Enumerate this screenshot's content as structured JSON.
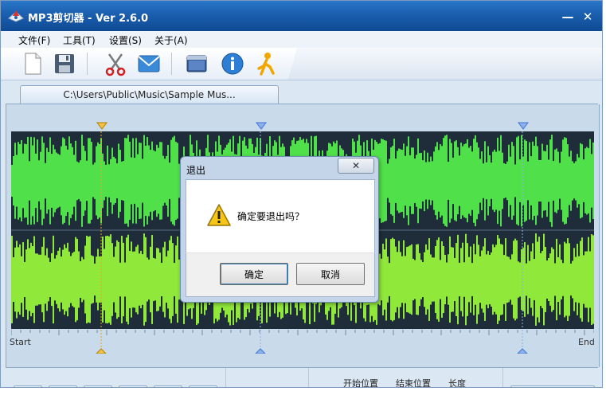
{
  "window": {
    "title": "MP3剪切器 - Ver 2.6.0",
    "minimize": "—",
    "close": "✕"
  },
  "menu": {
    "items": [
      "文件(F)",
      "工具(T)",
      "设置(S)",
      "关于(A)"
    ]
  },
  "toolbar": {
    "icons": [
      "new-file-icon",
      "save-icon",
      "cut-scissors-icon",
      "email-icon",
      "window-icon",
      "info-icon",
      "runner-icon"
    ]
  },
  "tab": {
    "label": "C:\\Users\\Public\\Music\\Sample Mus..."
  },
  "waveform": {
    "colors": {
      "background": "#1f2d3a",
      "wave": "#4fe04a",
      "marker_start": "#e6a817",
      "marker_blue": "#3d77d6"
    },
    "ruler_start": "Start",
    "ruler_end": "End"
  },
  "bottom_panel": {
    "columns": [
      "开始位置",
      "结束位置",
      "长度"
    ]
  },
  "dialog": {
    "title": "退出",
    "message": "确定要退出吗？",
    "ok_label": "确定",
    "cancel_label": "取消",
    "close_glyph": "✕"
  }
}
